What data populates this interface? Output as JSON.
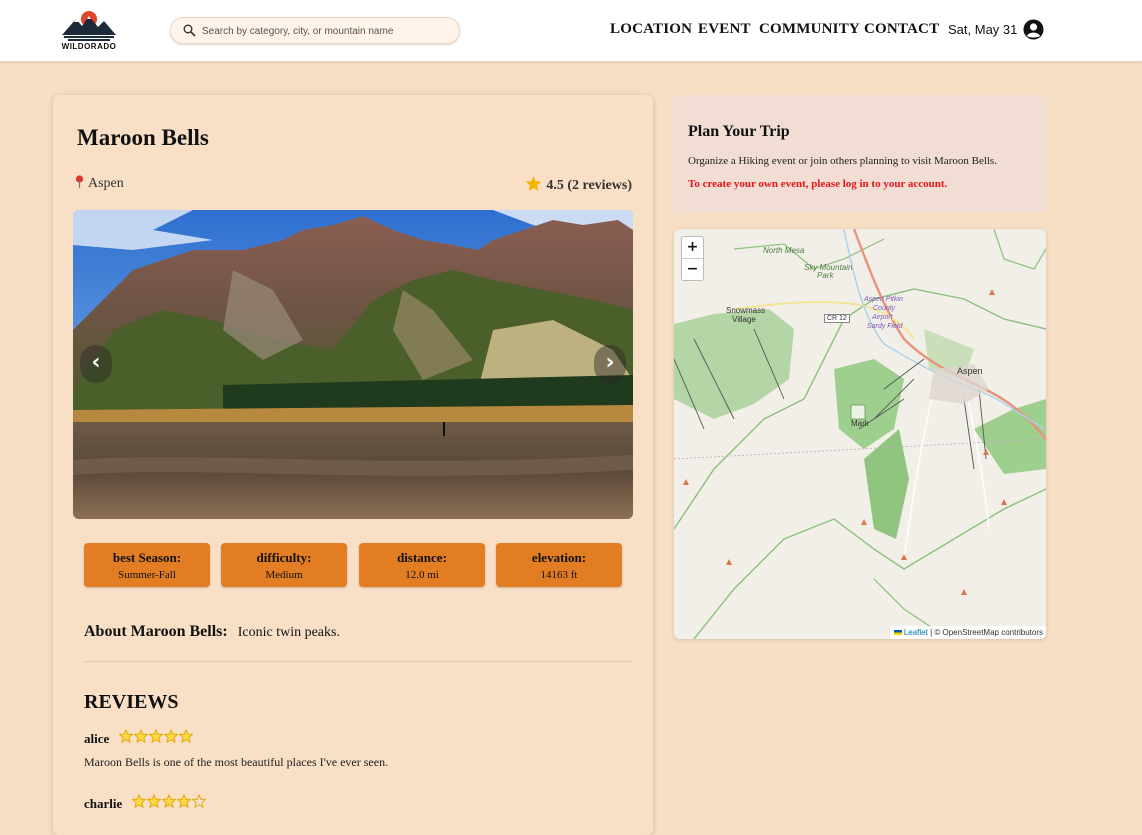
{
  "header": {
    "logo_text": "WILDORADO",
    "search_placeholder": "Search by category, city, or mountain name",
    "nav": [
      "LOCATION",
      "EVENT",
      "COMMUNITY",
      "CONTACT"
    ],
    "date": "Sat, May 31"
  },
  "place": {
    "name": "Maroon Bells",
    "location": "Aspen",
    "rating": "4.5 (2 reviews)",
    "stats": [
      {
        "label": "best Season:",
        "value": "Summer-Fall"
      },
      {
        "label": "difficulty:",
        "value": "Medium"
      },
      {
        "label": "distance:",
        "value": "12.0 mi"
      },
      {
        "label": "elevation:",
        "value": "14163 ft"
      }
    ],
    "about_label": "About Maroon Bells:",
    "about_text": "Iconic twin peaks."
  },
  "carousel": {
    "prev": "‹",
    "next": "›"
  },
  "reviews": {
    "title": "REVIEWS",
    "items": [
      {
        "user": "alice",
        "stars": 5,
        "text": "Maroon Bells is one of the most beautiful places I've ever seen."
      },
      {
        "user": "charlie",
        "stars": 4,
        "text": ""
      }
    ]
  },
  "plan": {
    "title": "Plan Your Trip",
    "description": "Organize a Hiking event or join others planning to visit Maroon Bells.",
    "login_prompt": "To create your own event, please log in to your account."
  },
  "map": {
    "zoom_in": "+",
    "zoom_out": "−",
    "leaflet": "Leaflet",
    "attribution": "| © OpenStreetMap contributors",
    "labels": {
      "north_mesa": "North Mesa",
      "sky_mountain": "Sky Mountain",
      "park": "Park",
      "snowmass": "Snowmass",
      "village": "Village",
      "cr12": "CR 12",
      "airport1": "Aspen Pitkin",
      "airport2": "County",
      "airport3": "Airport",
      "airport4": "Sardy Field",
      "aspen": "Aspen",
      "marker": "Mark"
    }
  },
  "colors": {
    "background": "#f7dfc5",
    "accent": "#e27d23",
    "alert": "#e8141a",
    "star": "#f5b400"
  }
}
